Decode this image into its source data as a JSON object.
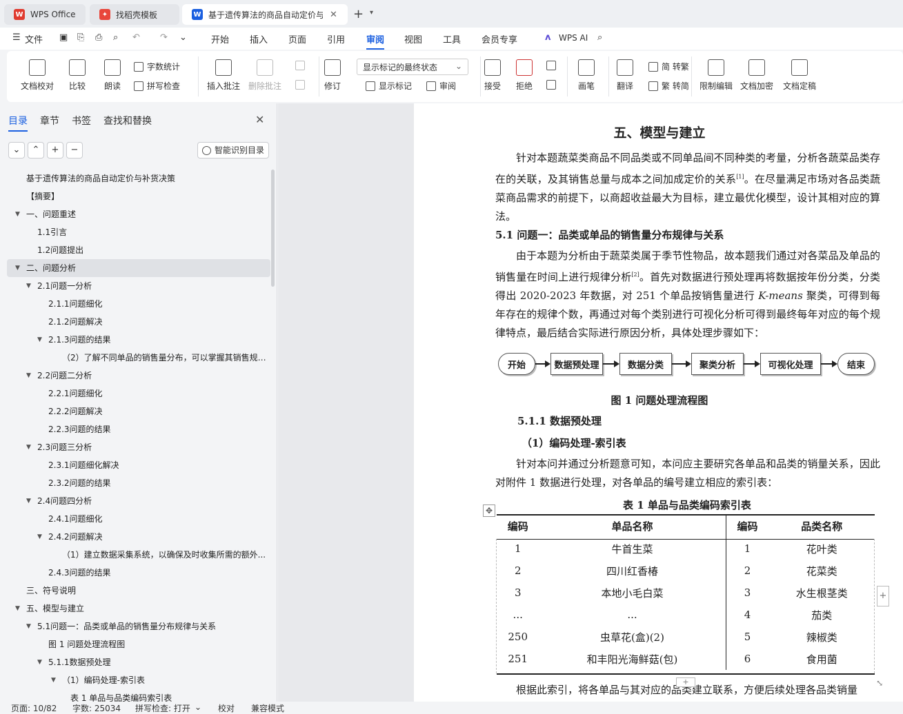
{
  "tabs": {
    "wps": "WPS Office",
    "template": "找稻壳模板",
    "doc": "基于遗传算法的商品自动定价与补货决策"
  },
  "menu": {
    "file": "文件",
    "items": [
      "开始",
      "插入",
      "页面",
      "引用",
      "审阅",
      "视图",
      "工具",
      "会员专享"
    ],
    "active": "审阅",
    "ai": "WPS AI"
  },
  "ribbon": {
    "proofread": "文档校对",
    "compare": "比较",
    "read": "朗读",
    "wordcount": "字数统计",
    "spellcheck": "拼写检查",
    "insert_comment": "插入批注",
    "delete_comment": "删除批注",
    "revise": "修订",
    "markup_state": "显示标记的最终状态",
    "show_markup": "显示标记",
    "review": "审阅",
    "accept": "接受",
    "reject": "拒绝",
    "pen": "画笔",
    "translate": "翻译",
    "to_trad": "简 转繁",
    "to_simp": "繁 转简",
    "restrict": "限制编辑",
    "encrypt": "文档加密",
    "finalize": "文档定稿"
  },
  "sidebar": {
    "tabs": [
      "目录",
      "章节",
      "书签",
      "查找和替换"
    ],
    "smart_toc": "智能识别目录",
    "toc": [
      {
        "text": "基于遗传算法的商品自动定价与补货决策",
        "level": 0,
        "caret": ""
      },
      {
        "text": "【摘要】",
        "level": 0,
        "caret": ""
      },
      {
        "text": "一、问题重述",
        "level": 0,
        "caret": "open"
      },
      {
        "text": "1.1引言",
        "level": 1,
        "caret": ""
      },
      {
        "text": "1.2问题提出",
        "level": 1,
        "caret": ""
      },
      {
        "text": "二、问题分析",
        "level": 0,
        "caret": "open",
        "selected": true
      },
      {
        "text": "2.1问题一分析",
        "level": 1,
        "caret": "open"
      },
      {
        "text": "2.1.1问题细化",
        "level": 2,
        "caret": ""
      },
      {
        "text": "2.1.2问题解决",
        "level": 2,
        "caret": ""
      },
      {
        "text": "2.1.3问题的结果",
        "level": 2,
        "caret": "open"
      },
      {
        "text": "（2）了解不同单品的销售量分布，可以掌握其销售规律...",
        "level": 3,
        "caret": ""
      },
      {
        "text": "2.2问题二分析",
        "level": 1,
        "caret": "open"
      },
      {
        "text": "2.2.1问题细化",
        "level": 2,
        "caret": ""
      },
      {
        "text": "2.2.2问题解决",
        "level": 2,
        "caret": ""
      },
      {
        "text": "2.2.3问题的结果",
        "level": 2,
        "caret": ""
      },
      {
        "text": "2.3问题三分析",
        "level": 1,
        "caret": "open"
      },
      {
        "text": "2.3.1问题细化解决",
        "level": 2,
        "caret": ""
      },
      {
        "text": "2.3.2问题的结果",
        "level": 2,
        "caret": ""
      },
      {
        "text": "2.4问题四分析",
        "level": 1,
        "caret": "open"
      },
      {
        "text": "2.4.1问题细化",
        "level": 2,
        "caret": ""
      },
      {
        "text": "2.4.2问题解决",
        "level": 2,
        "caret": "open"
      },
      {
        "text": "（1）建立数据采集系统，以确保及时收集所需的额外...",
        "level": 3,
        "caret": ""
      },
      {
        "text": "2.4.3问题的结果",
        "level": 2,
        "caret": ""
      },
      {
        "text": "三、符号说明",
        "level": 0,
        "caret": ""
      },
      {
        "text": "五、模型与建立",
        "level": 0,
        "caret": "open"
      },
      {
        "text": "5.1问题一：品类或单品的销售量分布规律与关系",
        "level": 1,
        "caret": "open"
      },
      {
        "text": "图 1 问题处理流程图",
        "level": 2,
        "caret": ""
      },
      {
        "text": "5.1.1数据预处理",
        "level": 2,
        "caret": "open"
      },
      {
        "text": "（1）编码处理-索引表",
        "level": 3,
        "caret": "open"
      },
      {
        "text": "表 1 单品与品类编码索引表",
        "level": 4,
        "caret": ""
      }
    ]
  },
  "doc": {
    "title": "五、模型与建立",
    "p1": "针对本题蔬菜类商品不同品类或不同单品间不同种类的考量，分析各蔬菜品类存在的关联，及其销售总量与成本之间加成定价的关系",
    "p1_ref": "[1]",
    "p1b": "。在尽量满足市场对各品类蔬菜商品需求的前提下，以商超收益最大为目标，建立最优化模型，设计其相对应的算法。",
    "h51": "5.1 问题一：品类或单品的销售量分布规律与关系",
    "p2a": "由于本题为分析由于蔬菜类属于季节性物品，故本题我们通过对各菜品及单品的销售量在时间上进行规律分析",
    "p2_ref": "[2]",
    "p2b": "。首先对数据进行预处理再将数据按年份分类，分类得出 2020-2023 年数据，对 251 个单品按销售量进行 ",
    "p2_em": "K-means",
    "p2c": " 聚类，可得到每年存在的规律个数，再通过对每个类别进行可视化分析可得到最终每年对应的每个规律特点，最后结合实际进行原因分析，具体处理步骤如下：",
    "flow": [
      "开始",
      "数据预处理",
      "数据分类",
      "聚类分析",
      "可视化处理",
      "结束"
    ],
    "fig_caption": "图 1   问题处理流程图",
    "h511": "5.1.1 数据预处理",
    "h_enc": "（1）编码处理-索引表",
    "p3": "针对本问并通过分析题意可知，本问应主要研究各单品和品类的销量关系，因此对附件 1 数据进行处理，对各单品的编号建立相应的索引表：",
    "table_caption": "表 1   单品与品类编码索引表",
    "table_headers": [
      "编码",
      "单品名称",
      "编码",
      "品类名称"
    ],
    "table_rows": [
      [
        "1",
        "牛首生菜",
        "1",
        "花叶类"
      ],
      [
        "2",
        "四川红香椿",
        "2",
        "花菜类"
      ],
      [
        "3",
        "本地小毛白菜",
        "3",
        "水生根茎类"
      ],
      [
        "...",
        "...",
        "4",
        "茄类"
      ],
      [
        "250",
        "虫草花(盒)(2)",
        "5",
        "辣椒类"
      ],
      [
        "251",
        "和丰阳光海鲜菇(包)",
        "6",
        "食用菌"
      ]
    ],
    "p4": "根据此索引，将各单品与其对应的品类建立联系，方便后续处理各品类销量"
  },
  "status": {
    "page": "页面: 10/82",
    "words": "字数: 25034",
    "spell": "拼写检查: 打开",
    "proof": "校对",
    "compat": "兼容模式"
  },
  "colors": {
    "accent": "#1a5fe0",
    "wps_red": "#e03a2f"
  }
}
